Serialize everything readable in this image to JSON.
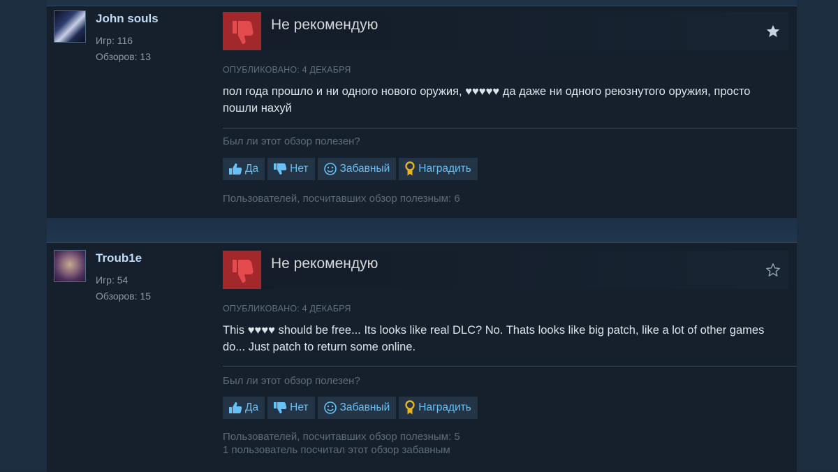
{
  "reviews": [
    {
      "author": {
        "name": "John souls",
        "games": "Игр: 116",
        "reviews": "Обзоров: 13",
        "avatar": "dark-blue-anime-avatar"
      },
      "verdict": "Не рекомендую",
      "star_filled": true,
      "posted": "ОПУБЛИКОВАНО: 4 ДЕКАБРЯ",
      "text": "пол года прошло и ни одного нового оружия, ♥♥♥♥♥ да даже ни одного реюзнутого оружия, просто пошли нахуй",
      "helpful_question": "Был ли этот обзор полезен?",
      "buttons": {
        "yes": "Да",
        "no": "Нет",
        "funny": "Забавный",
        "award": "Наградить"
      },
      "helpful_count": "Пользователей, посчитавших обзор полезным: 6"
    },
    {
      "author": {
        "name": "Troub1e",
        "games": "Игр: 54",
        "reviews": "Обзоров: 15",
        "avatar": "purple-portrait-avatar"
      },
      "verdict": "Не рекомендую",
      "star_filled": false,
      "posted": "ОПУБЛИКОВАНО: 4 ДЕКАБРЯ",
      "text": "This ♥♥♥♥ should be free... Its looks like real DLC? No. Thats looks like big patch, like a lot of other games do... Just patch to return some online.",
      "helpful_question": "Был ли этот обзор полезен?",
      "buttons": {
        "yes": "Да",
        "no": "Нет",
        "funny": "Забавный",
        "award": "Наградить"
      },
      "helpful_count": "Пользователей, посчитавших обзор полезным: 5",
      "funny_count": "1 пользователь посчитал этот обзор забавным"
    }
  ],
  "colors": {
    "page_background": "#1b2838",
    "card_background": "#16202d",
    "thumb_down_box": "#a3282c",
    "link_blue": "#67c1f5",
    "author_name": "#c1dbf4",
    "award_gold": "#e4b422"
  },
  "icons": {
    "thumb": "thumbs-down-icon",
    "star_filled": "star-icon",
    "star_outline": "star-outline-icon",
    "yes": "thumbs-up-icon",
    "no": "thumbs-down-icon",
    "funny": "smiley-icon",
    "award": "award-medal-icon"
  }
}
